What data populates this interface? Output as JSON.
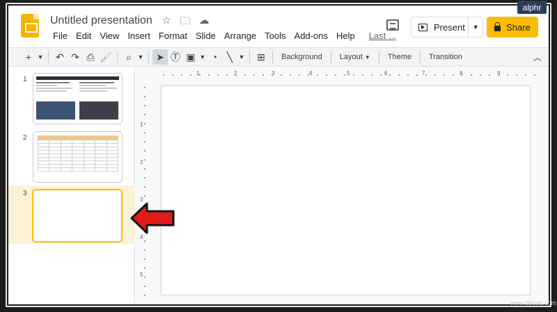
{
  "app": {
    "title": "Untitled presentation",
    "icons": [
      "star-icon",
      "move-to-folder-icon",
      "cloud-saved-icon"
    ]
  },
  "menu": [
    "File",
    "Edit",
    "View",
    "Insert",
    "Format",
    "Slide",
    "Arrange",
    "Tools",
    "Add-ons",
    "Help"
  ],
  "last_edit": "Last ...",
  "present_label": "Present",
  "share_label": "Share",
  "accent": "#fbbc04",
  "toolbar": {
    "background": "Background",
    "layout": "Layout",
    "theme": "Theme",
    "transition": "Transition"
  },
  "slides": [
    {
      "num": "1"
    },
    {
      "num": "2"
    },
    {
      "num": "3"
    }
  ],
  "ruler": {
    "top": [
      "1",
      "2",
      "3",
      "4",
      "5",
      "6",
      "7",
      "8",
      "9"
    ],
    "left": [
      "1",
      "2",
      "3",
      "4",
      "5"
    ]
  },
  "watermark": "alphr",
  "site_mark": "www.deuaq.com"
}
